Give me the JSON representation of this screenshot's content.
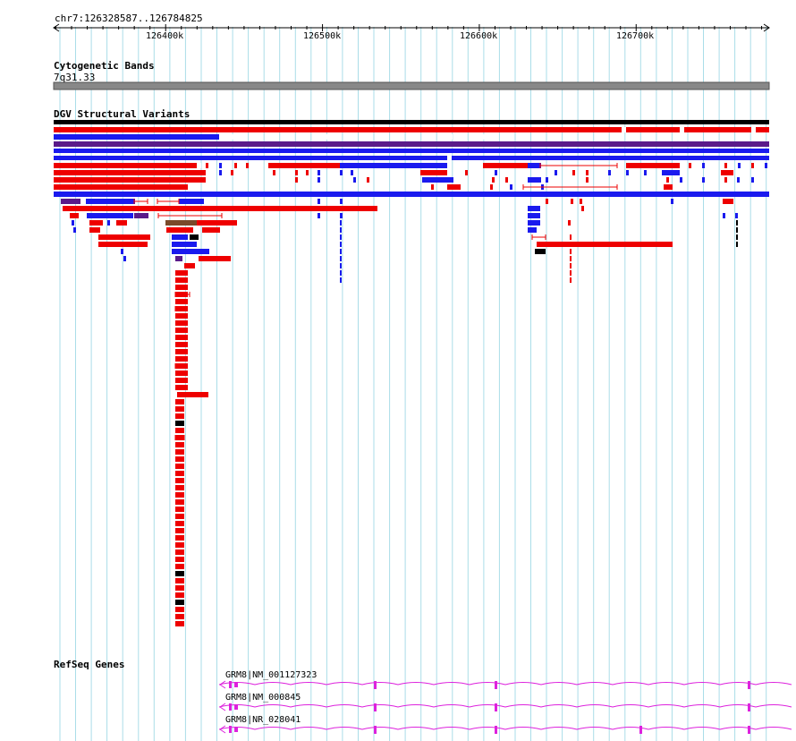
{
  "ruler": {
    "position_text": "chr7:126328587..126784825",
    "start": 126328587,
    "end": 126784825,
    "ticks": [
      {
        "value": 126400000,
        "label": "126400k"
      },
      {
        "value": 126500000,
        "label": "126500k"
      },
      {
        "value": 126600000,
        "label": "126600k"
      },
      {
        "value": 126700000,
        "label": "126700k"
      }
    ]
  },
  "tracks": {
    "cytoband": {
      "title": "Cytogenetic Bands",
      "band_label": "7q31.33"
    },
    "dgv": {
      "title": "DGV Structural Variants"
    },
    "refseq": {
      "title": "RefSeq Genes",
      "genes": [
        {
          "label": "GRM8|NM_001127323"
        },
        {
          "label": "GRM8|NM_000845"
        },
        {
          "label": "GRM8|NR_028041"
        }
      ]
    }
  },
  "colors": {
    "gain": "#ee0000",
    "loss": "#1a1aee",
    "complex": "#000000",
    "inversion": "#7a4a2a",
    "other": "#5a1a8a",
    "gene": "#dd22dd",
    "grid": "#aadde8",
    "band": "#888888"
  }
}
